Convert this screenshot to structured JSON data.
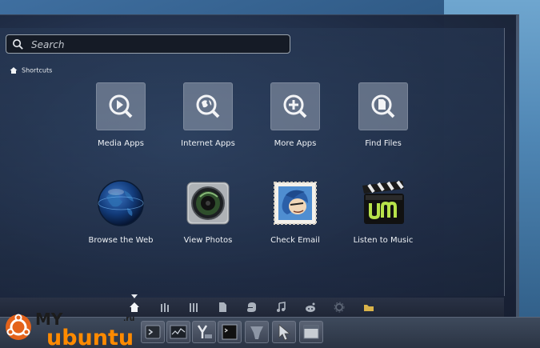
{
  "search": {
    "placeholder": "Search"
  },
  "breadcrumb": {
    "label": "Shortcuts"
  },
  "shortcuts": [
    {
      "label": "Media Apps",
      "icon": "play-icon"
    },
    {
      "label": "Internet Apps",
      "icon": "globe-icon"
    },
    {
      "label": "More Apps",
      "icon": "plus-icon"
    },
    {
      "label": "Find Files",
      "icon": "file-icon"
    }
  ],
  "apps": [
    {
      "label": "Browse the Web",
      "icon": "globe-browser-icon"
    },
    {
      "label": "View Photos",
      "icon": "camera-lens-icon"
    },
    {
      "label": "Check Email",
      "icon": "stamp-mail-icon"
    },
    {
      "label": "Listen to Music",
      "icon": "clapperboard-icon"
    }
  ],
  "filterbar": [
    "home-icon",
    "applications-icon",
    "tools-icon",
    "files-icon",
    "python-icon",
    "music-icon",
    "reddit-icon",
    "gear-icon",
    "folder-icon"
  ],
  "launcher": [
    "terminal-app",
    "system-monitor-app",
    "yppa-app",
    "terminal-black-app",
    "tray-app",
    "cursor-app",
    "window-app"
  ],
  "watermark": {
    "text": "MY ubuntu",
    "wordmark": "MY",
    "sub": "ubuntu",
    "tld": ".ru"
  },
  "colors": {
    "accent": "#ff8a00",
    "panel": "#1f2636"
  }
}
